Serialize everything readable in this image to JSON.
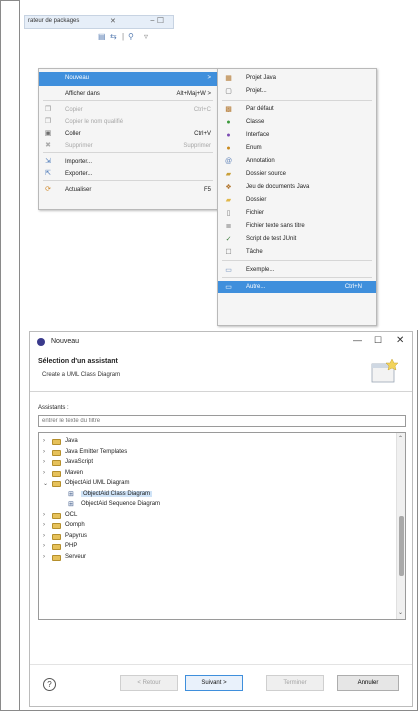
{
  "package_explorer": {
    "tab_title": "rateur de packages",
    "close_glyph": "✕",
    "minmax_glyph": "− ☐",
    "toolbar_icons": [
      "collapse-icon",
      "link-icon",
      "filter-icon",
      "view-menu-icon"
    ]
  },
  "context_menu": {
    "items": [
      {
        "label": "Nouveau",
        "shortcut": ">",
        "icon": "",
        "state": "highlight"
      },
      {
        "label": "Afficher dans",
        "shortcut": "Alt+Maj+W >",
        "icon": "",
        "state": "normal"
      },
      {
        "label": "Copier",
        "shortcut": "Ctrl+C",
        "icon": "copy-icon",
        "state": "disabled"
      },
      {
        "label": "Copier le nom qualifié",
        "shortcut": "",
        "icon": "copy-qualified-icon",
        "state": "disabled"
      },
      {
        "label": "Coller",
        "shortcut": "Ctrl+V",
        "icon": "paste-icon",
        "state": "normal"
      },
      {
        "label": "Supprimer",
        "shortcut": "Supprimer",
        "icon": "delete-icon",
        "state": "disabled"
      },
      {
        "label": "Importer...",
        "shortcut": "",
        "icon": "import-icon",
        "state": "normal"
      },
      {
        "label": "Exporter...",
        "shortcut": "",
        "icon": "export-icon",
        "state": "normal"
      },
      {
        "label": "Actualiser",
        "shortcut": "F5",
        "icon": "refresh-icon",
        "state": "normal"
      }
    ]
  },
  "submenu": {
    "items": [
      {
        "label": "Projet Java",
        "shortcut": "",
        "icon": "java-project-icon",
        "state": "normal"
      },
      {
        "label": "Projet...",
        "shortcut": "",
        "icon": "project-icon",
        "state": "normal"
      },
      {
        "label": "Par défaut",
        "shortcut": "",
        "icon": "package-icon",
        "state": "normal"
      },
      {
        "label": "Classe",
        "shortcut": "",
        "icon": "class-icon",
        "state": "normal"
      },
      {
        "label": "Interface",
        "shortcut": "",
        "icon": "interface-icon",
        "state": "normal"
      },
      {
        "label": "Enum",
        "shortcut": "",
        "icon": "enum-icon",
        "state": "normal"
      },
      {
        "label": "Annotation",
        "shortcut": "",
        "icon": "annotation-icon",
        "state": "normal"
      },
      {
        "label": "Dossier source",
        "shortcut": "",
        "icon": "source-folder-icon",
        "state": "normal"
      },
      {
        "label": "Jeu de documents Java",
        "shortcut": "",
        "icon": "working-set-icon",
        "state": "normal"
      },
      {
        "label": "Dossier",
        "shortcut": "",
        "icon": "folder-icon",
        "state": "normal"
      },
      {
        "label": "Fichier",
        "shortcut": "",
        "icon": "file-icon",
        "state": "normal"
      },
      {
        "label": "Fichier texte sans titre",
        "shortcut": "",
        "icon": "untitled-text-file-icon",
        "state": "normal"
      },
      {
        "label": "Script de test JUnit",
        "shortcut": "",
        "icon": "junit-icon",
        "state": "normal"
      },
      {
        "label": "Tâche",
        "shortcut": "",
        "icon": "task-icon",
        "state": "normal"
      },
      {
        "label": "Exemple...",
        "shortcut": "",
        "icon": "example-icon",
        "state": "normal"
      },
      {
        "label": "Autre...",
        "shortcut": "Ctrl+N",
        "icon": "other-icon",
        "state": "highlight"
      }
    ]
  },
  "wizard": {
    "window_title": "Nouveau",
    "minimize": "—",
    "maximize": "☐",
    "close": "✕",
    "heading": "Sélection d'un assistant",
    "description": "Create a UML Class Diagram",
    "assistants_label": "Assistants :",
    "filter_placeholder": "entrer le texte du filtre",
    "tree": [
      {
        "label": "Java",
        "level": 0,
        "type": "folder",
        "expanded": false
      },
      {
        "label": "Java Emitter Templates",
        "level": 0,
        "type": "folder",
        "expanded": false
      },
      {
        "label": "JavaScript",
        "level": 0,
        "type": "folder",
        "expanded": false
      },
      {
        "label": "Maven",
        "level": 0,
        "type": "folder",
        "expanded": false
      },
      {
        "label": "ObjectAid UML Diagram",
        "level": 0,
        "type": "folder",
        "expanded": true
      },
      {
        "label": "ObjectAid Class Diagram",
        "level": 1,
        "type": "item",
        "selected": true
      },
      {
        "label": "ObjectAid Sequence Diagram",
        "level": 1,
        "type": "item",
        "selected": false
      },
      {
        "label": "OCL",
        "level": 0,
        "type": "folder",
        "expanded": false
      },
      {
        "label": "Oomph",
        "level": 0,
        "type": "folder",
        "expanded": false
      },
      {
        "label": "Papyrus",
        "level": 0,
        "type": "folder",
        "expanded": false
      },
      {
        "label": "PHP",
        "level": 0,
        "type": "folder",
        "expanded": false
      },
      {
        "label": "Serveur",
        "level": 0,
        "type": "folder",
        "expanded": false
      }
    ],
    "buttons": {
      "help": "?",
      "back": "< Retour",
      "next": "Suivant >",
      "finish": "Terminer",
      "cancel": "Annuler"
    }
  },
  "colors": {
    "highlight": "#3f8fdc",
    "selection": "#cfe3f7",
    "folder": "#e6c15a"
  }
}
